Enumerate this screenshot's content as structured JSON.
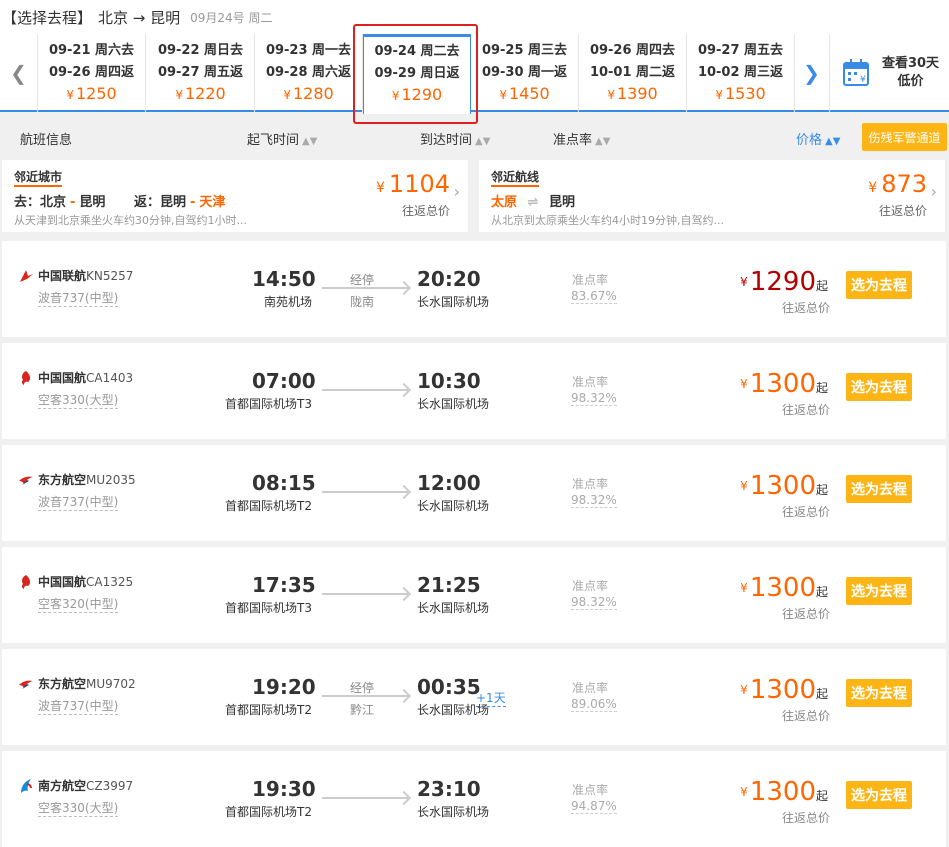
{
  "header": {
    "title": "【选择去程】",
    "route": "北京 → 昆明",
    "date": "09月24号 周二"
  },
  "dates": [
    {
      "go": "09-21 周六去",
      "ret": "09-26 周四返",
      "price": "1250"
    },
    {
      "go": "09-22 周日去",
      "ret": "09-27 周五返",
      "price": "1220"
    },
    {
      "go": "09-23 周一去",
      "ret": "09-28 周六返",
      "price": "1280"
    },
    {
      "go": "09-24 周二去",
      "ret": "09-29 周日返",
      "price": "1290"
    },
    {
      "go": "09-25 周三去",
      "ret": "09-30 周一返",
      "price": "1450"
    },
    {
      "go": "09-26 周四去",
      "ret": "10-01 周二返",
      "price": "1390"
    },
    {
      "go": "09-27 周五去",
      "ret": "10-02 周三返",
      "price": "1530"
    }
  ],
  "currency": "¥",
  "calendar": {
    "line1": "查看30天",
    "line2": "低价"
  },
  "sort": {
    "info": "航班信息",
    "dep": "起飞时间",
    "arr": "到达时间",
    "ontime": "准点率",
    "price": "价格",
    "military": "伤残军警通道"
  },
  "nearby_city": {
    "tag": "邻近城市",
    "go_label": "去：北京",
    "go_dest": "昆明",
    "ret_label": "返：昆明",
    "ret_dest": "天津",
    "desc": "从天津到北京乘坐火车约30分钟,自驾约1小时...",
    "price": "1104",
    "sub": "往返总价"
  },
  "nearby_route": {
    "tag": "邻近航线",
    "from": "太原",
    "to": "昆明",
    "desc": "从北京到太原乘坐火车约4小时19分钟,自驾约...",
    "price": "873",
    "sub": "往返总价"
  },
  "flights": [
    {
      "airline": "中国联航",
      "code": "KN5257",
      "plane": "波音737(中型)",
      "dep": "14:50",
      "dep_apt": "南苑机场",
      "stop": "经停",
      "stop_city": "陇南",
      "arr": "20:20",
      "plus": "",
      "arr_apt": "长水国际机场",
      "ontime_label": "准点率",
      "ontime": "83.67%",
      "price": "1290",
      "qi": "起",
      "sub": "往返总价",
      "btn": "选为去程",
      "logo": "cu"
    },
    {
      "airline": "中国国航",
      "code": "CA1403",
      "plane": "空客330(大型)",
      "dep": "07:00",
      "dep_apt": "首都国际机场T3",
      "stop": "",
      "stop_city": "",
      "arr": "10:30",
      "plus": "",
      "arr_apt": "长水国际机场",
      "ontime_label": "准点率",
      "ontime": "98.32%",
      "price": "1300",
      "qi": "起",
      "sub": "往返总价",
      "btn": "选为去程",
      "logo": "ca"
    },
    {
      "airline": "东方航空",
      "code": "MU2035",
      "plane": "波音737(中型)",
      "dep": "08:15",
      "dep_apt": "首都国际机场T2",
      "stop": "",
      "stop_city": "",
      "arr": "12:00",
      "plus": "",
      "arr_apt": "长水国际机场",
      "ontime_label": "准点率",
      "ontime": "98.32%",
      "price": "1300",
      "qi": "起",
      "sub": "往返总价",
      "btn": "选为去程",
      "logo": "mu"
    },
    {
      "airline": "中国国航",
      "code": "CA1325",
      "plane": "空客320(中型)",
      "dep": "17:35",
      "dep_apt": "首都国际机场T3",
      "stop": "",
      "stop_city": "",
      "arr": "21:25",
      "plus": "",
      "arr_apt": "长水国际机场",
      "ontime_label": "准点率",
      "ontime": "98.32%",
      "price": "1300",
      "qi": "起",
      "sub": "往返总价",
      "btn": "选为去程",
      "logo": "ca"
    },
    {
      "airline": "东方航空",
      "code": "MU9702",
      "plane": "波音737(中型)",
      "dep": "19:20",
      "dep_apt": "首都国际机场T2",
      "stop": "经停",
      "stop_city": "黔江",
      "arr": "00:35",
      "plus": "+1天",
      "arr_apt": "长水国际机场",
      "ontime_label": "准点率",
      "ontime": "89.06%",
      "price": "1300",
      "qi": "起",
      "sub": "往返总价",
      "btn": "选为去程",
      "logo": "mu"
    },
    {
      "airline": "南方航空",
      "code": "CZ3997",
      "plane": "空客330(大型)",
      "dep": "19:30",
      "dep_apt": "首都国际机场T2",
      "stop": "",
      "stop_city": "",
      "arr": "23:10",
      "plus": "",
      "arr_apt": "长水国际机场",
      "ontime_label": "准点率",
      "ontime": "94.87%",
      "price": "1300",
      "qi": "起",
      "sub": "往返总价",
      "btn": "选为去程",
      "logo": "cz"
    }
  ],
  "colors": {
    "accent": "#3a8be6",
    "price": "#ff6600",
    "button": "#fdb515",
    "highlight": "#e02020"
  }
}
